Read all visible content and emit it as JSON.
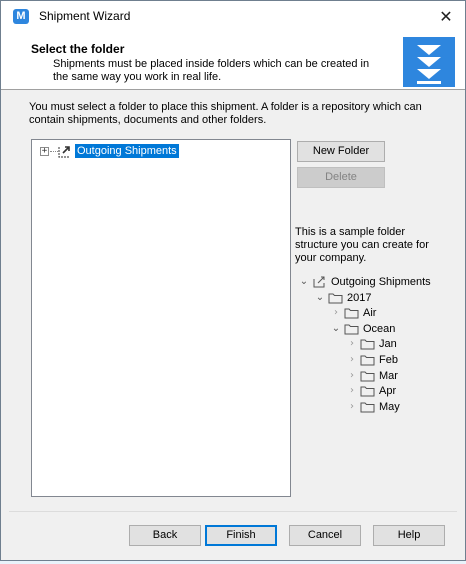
{
  "window": {
    "title": "Shipment Wizard",
    "app_icon_letter": "M"
  },
  "header": {
    "title": "Select the folder",
    "subtitle": "Shipments must be placed inside folders which can be created in the same way you work in real life."
  },
  "intro_text": "You must select a folder to place this shipment. A folder is a repository which can contain shipments, documents and other folders.",
  "tree": {
    "root_label": "Outgoing Shipments",
    "root_expander": "+"
  },
  "side_buttons": {
    "new_folder": "New Folder",
    "delete": "Delete"
  },
  "sample": {
    "description": "This is a sample folder structure you can create for your company.",
    "nodes": [
      {
        "label": "Outgoing Shipments",
        "level": 0,
        "expanded": true,
        "icon": "shortcut-folder-icon"
      },
      {
        "label": "2017",
        "level": 1,
        "expanded": true,
        "icon": "folder-icon"
      },
      {
        "label": "Air",
        "level": 2,
        "expanded": false,
        "icon": "folder-icon"
      },
      {
        "label": "Ocean",
        "level": 2,
        "expanded": true,
        "icon": "folder-icon"
      },
      {
        "label": "Jan",
        "level": 3,
        "expanded": false,
        "icon": "folder-icon"
      },
      {
        "label": "Feb",
        "level": 3,
        "expanded": false,
        "icon": "folder-icon"
      },
      {
        "label": "Mar",
        "level": 3,
        "expanded": false,
        "icon": "folder-icon"
      },
      {
        "label": "Apr",
        "level": 3,
        "expanded": false,
        "icon": "folder-icon"
      },
      {
        "label": "May",
        "level": 3,
        "expanded": false,
        "icon": "folder-icon"
      }
    ]
  },
  "footer_buttons": {
    "back": "Back",
    "finish": "Finish",
    "cancel": "Cancel",
    "help": "Help"
  },
  "colors": {
    "accent": "#0078d7",
    "wizard_icon": "#2e86de"
  }
}
